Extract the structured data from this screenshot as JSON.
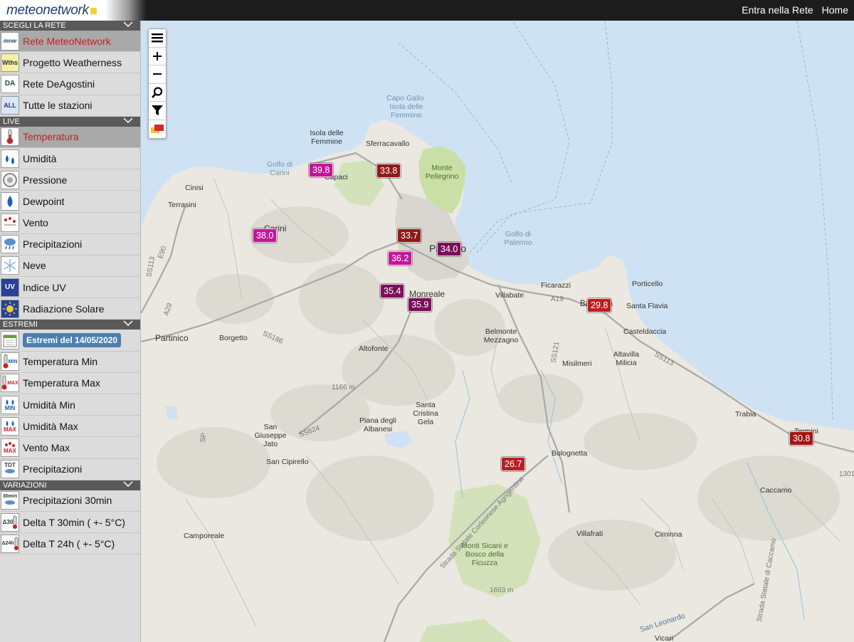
{
  "header": {
    "logo": "meteonetwork",
    "links": [
      "Entra nella Rete",
      "Home"
    ]
  },
  "sidebar": {
    "sections": [
      {
        "title": "SCEGLI LA RETE",
        "items": [
          {
            "label": "Rete MeteoNetwork",
            "icon": "mnw-icon",
            "icon_text": "mnw",
            "active": true
          },
          {
            "label": "Progetto Weatherness",
            "icon": "weatherness-icon",
            "icon_text": "Wths",
            "active": false
          },
          {
            "label": "Rete DeAgostini",
            "icon": "deagostini-icon",
            "icon_text": "DA",
            "active": false
          },
          {
            "label": "Tutte le stazioni",
            "icon": "all-stations-icon",
            "icon_text": "ALL",
            "active": false
          }
        ]
      },
      {
        "title": "LIVE",
        "items": [
          {
            "label": "Temperatura",
            "icon": "thermometer-icon",
            "active": true
          },
          {
            "label": "Umidità",
            "icon": "humidity-icon",
            "active": false
          },
          {
            "label": "Pressione",
            "icon": "pressure-icon",
            "active": false
          },
          {
            "label": "Dewpoint",
            "icon": "dewpoint-icon",
            "active": false
          },
          {
            "label": "Vento",
            "icon": "wind-icon",
            "active": false
          },
          {
            "label": "Precipitazioni",
            "icon": "rain-icon",
            "active": false
          },
          {
            "label": "Neve",
            "icon": "snow-icon",
            "active": false
          },
          {
            "label": "Indice UV",
            "icon": "uv-icon",
            "icon_text": "UV",
            "active": false
          },
          {
            "label": "Radiazione Solare",
            "icon": "sun-icon",
            "active": false
          }
        ]
      },
      {
        "title": "ESTREMI",
        "items": [
          {
            "label": "Estremi del 14/05/2020",
            "icon": "calendar-icon",
            "badge": true
          },
          {
            "label": "Temperatura Min",
            "icon": "temp-min-icon",
            "icon_text": "MIN"
          },
          {
            "label": "Temperatura Max",
            "icon": "temp-max-icon",
            "icon_text": "MAX"
          },
          {
            "label": "Umidità Min",
            "icon": "humidity-min-icon",
            "icon_text": "MIN"
          },
          {
            "label": "Umidità Max",
            "icon": "humidity-max-icon",
            "icon_text": "MAX"
          },
          {
            "label": "Vento Max",
            "icon": "wind-max-icon",
            "icon_text": "MAX"
          },
          {
            "label": "Precipitazioni",
            "icon": "rain-total-icon",
            "icon_text": "TOT"
          }
        ]
      },
      {
        "title": "VARIAZIONI",
        "items": [
          {
            "label": "Precipitazioni 30min",
            "icon": "rain-30min-icon",
            "icon_text": "30min"
          },
          {
            "label": "Delta T 30min ( +- 5°C)",
            "icon": "delta-t-30-icon",
            "icon_text": "Δ 30"
          },
          {
            "label": "Delta T 24h ( +- 5°C)",
            "icon": "delta-t-24-icon",
            "icon_text": "Δ 24h"
          }
        ]
      }
    ]
  },
  "map_controls": [
    "menu-icon",
    "zoom-in-icon",
    "zoom-out-icon",
    "search-icon",
    "filter-icon",
    "layers-icon"
  ],
  "markers": [
    {
      "value": "39.8",
      "color": "#c2169a"
    },
    {
      "value": "33.8",
      "color": "#8e1a1a"
    },
    {
      "value": "38.0",
      "color": "#c2169a"
    },
    {
      "value": "33.7",
      "color": "#8e1a1a"
    },
    {
      "value": "34.0",
      "color": "#7a0f5a"
    },
    {
      "value": "36.2",
      "color": "#c2169a"
    },
    {
      "value": "35.4",
      "color": "#7a0f5a"
    },
    {
      "value": "35.9",
      "color": "#7a0f5a"
    },
    {
      "value": "29.8",
      "color": "#bd1f1f"
    },
    {
      "value": "30.8",
      "color": "#a51414"
    },
    {
      "value": "26.7",
      "color": "#b81f26"
    }
  ],
  "places": [
    "Capo Gallo",
    "Isola delle Femmine",
    "Isola delle Femmine",
    "Sferracavallo",
    "Golfo di Carini",
    "Monte Pellegrino",
    "Capaci",
    "Cinisi",
    "Terrasini",
    "Carini",
    "Palermo",
    "Golfo di Palermo",
    "Ficarazzi",
    "Porticello",
    "Bagheria",
    "Santa Flavia",
    "Casteldaccia",
    "Villabate",
    "Monreale",
    "Belmonte Mezzagno",
    "Misilmeri",
    "Altavilla Milicia",
    "Partinico",
    "Borgetto",
    "Altofonte",
    "Trabia",
    "Termini",
    "Santa Cristina Gela",
    "Piana degli Albanesi",
    "San Giuseppe Jato",
    "San Cipirello",
    "Bolognetta",
    "Caccamo",
    "Camporeale",
    "Villafrati",
    "Ciminna",
    "Monti Sicani e Bosco della Ficuzza",
    "Vicari",
    "San Leonardo",
    "1166 m",
    "1603 m",
    "1301",
    "SS113",
    "SS186",
    "SS624",
    "SS121",
    "A19",
    "A29",
    "E90",
    "SP",
    "SS113",
    "Strada Statale Corleonese Agrigentina",
    "Strada Statale di Caccamo"
  ]
}
